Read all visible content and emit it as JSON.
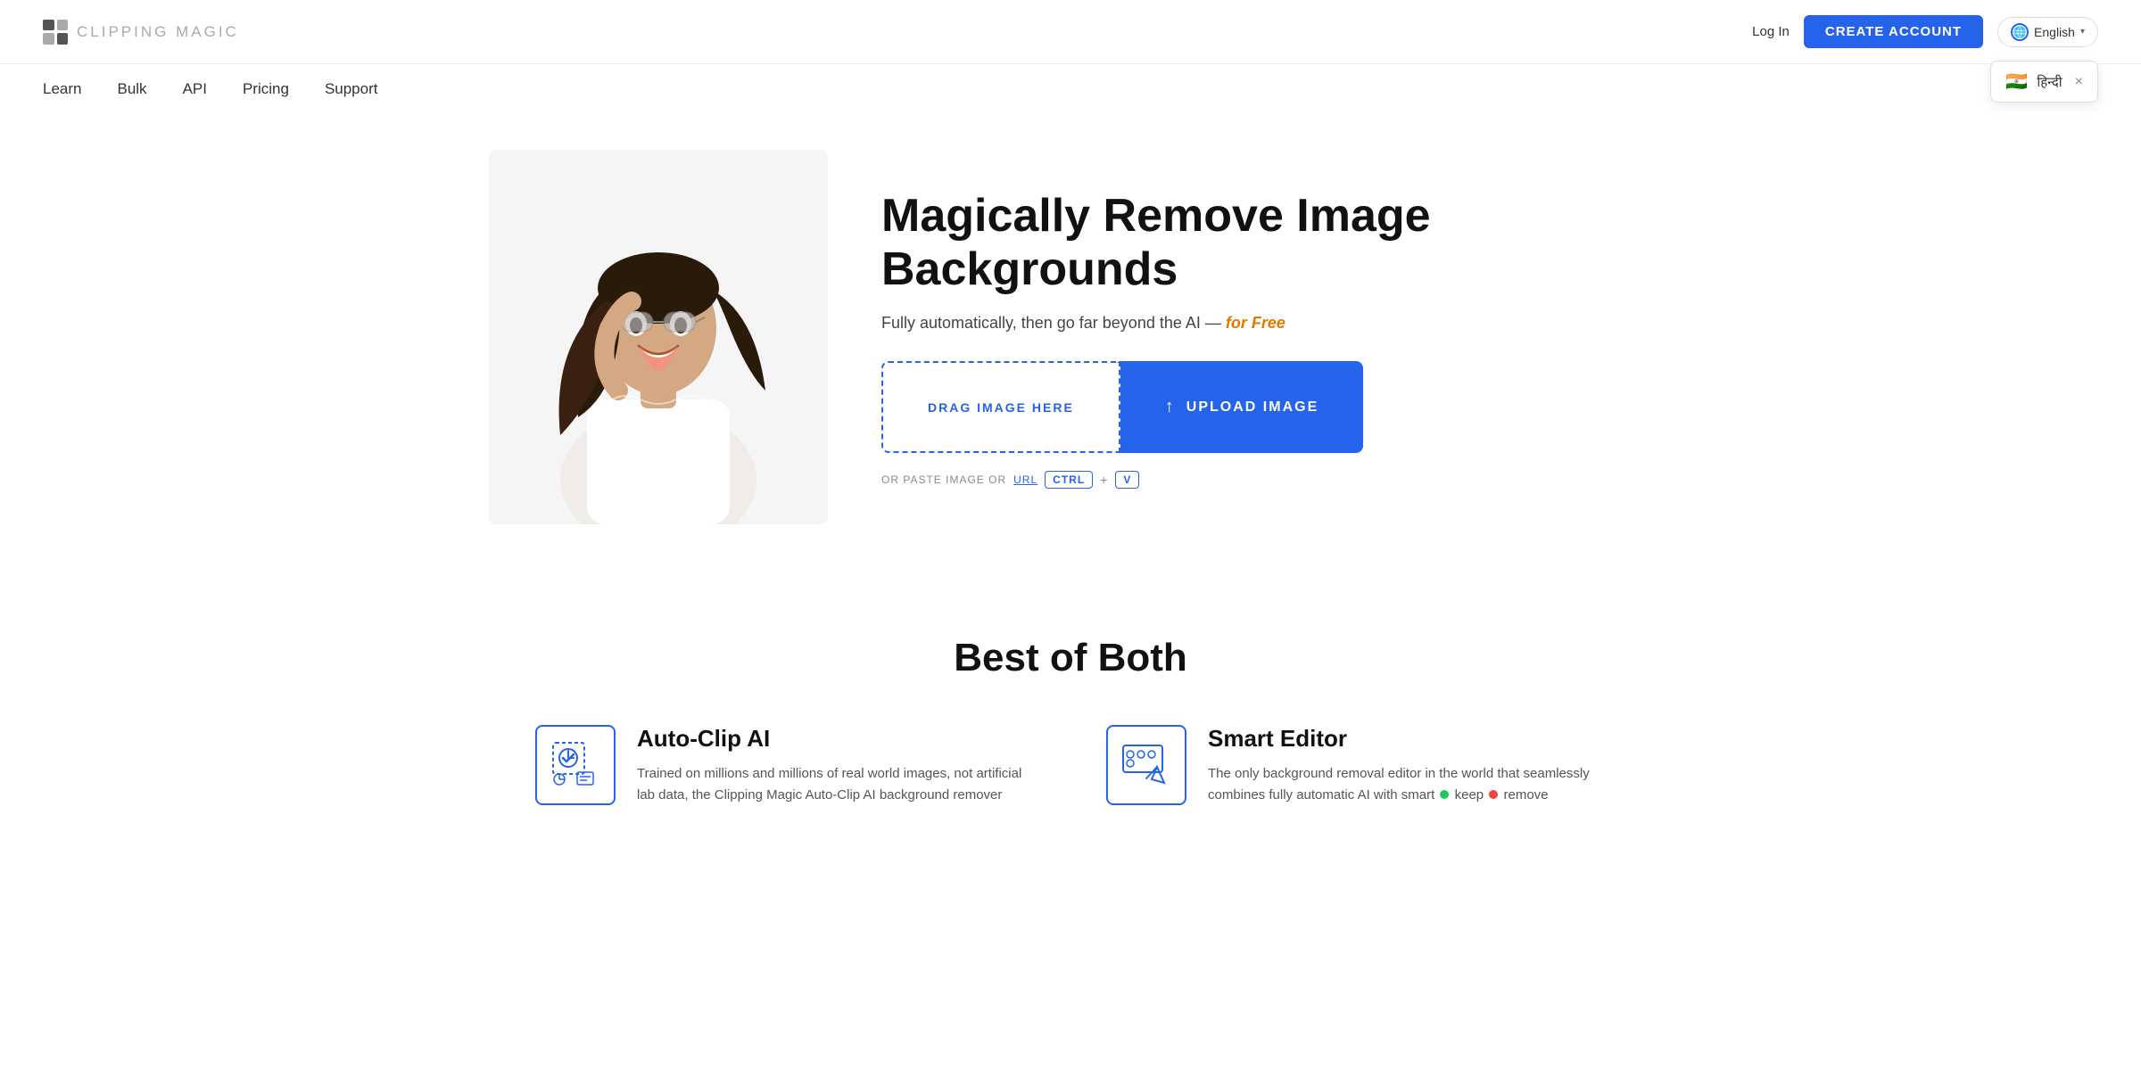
{
  "header": {
    "logo_text": "CLIPPING",
    "logo_text2": "MAGIC",
    "login_label": "Log In",
    "create_account_label": "CREATE ACCOUNT",
    "language_label": "English"
  },
  "lang_dropdown": {
    "flag": "🇮🇳",
    "text": "हिन्दी",
    "close_label": "×"
  },
  "nav": {
    "items": [
      {
        "label": "Learn"
      },
      {
        "label": "Bulk"
      },
      {
        "label": "API"
      },
      {
        "label": "Pricing"
      },
      {
        "label": "Support"
      }
    ]
  },
  "hero": {
    "title": "Magically Remove Image Backgrounds",
    "subtitle_pre": "Fully automatically, then go far beyond the AI — ",
    "subtitle_highlight": "for Free",
    "drag_label": "DRAG IMAGE HERE",
    "upload_label": "UPLOAD IMAGE",
    "paste_pre": "OR PASTE IMAGE OR",
    "url_label": "URL",
    "ctrl_key": "CTRL",
    "plus": "+",
    "v_key": "V"
  },
  "best_section": {
    "title": "Best of Both",
    "features": [
      {
        "name": "Auto-Clip AI",
        "description": "Trained on millions and millions of real world images, not artificial lab data, the Clipping Magic Auto-Clip AI background remover"
      },
      {
        "name": "Smart Editor",
        "description": "The only background removal editor in the world that seamlessly combines fully automatic AI with smart  keep  remove"
      }
    ]
  },
  "colors": {
    "blue": "#2563eb",
    "orange": "#e07b00",
    "text_dark": "#111",
    "text_mid": "#444",
    "text_light": "#888"
  }
}
